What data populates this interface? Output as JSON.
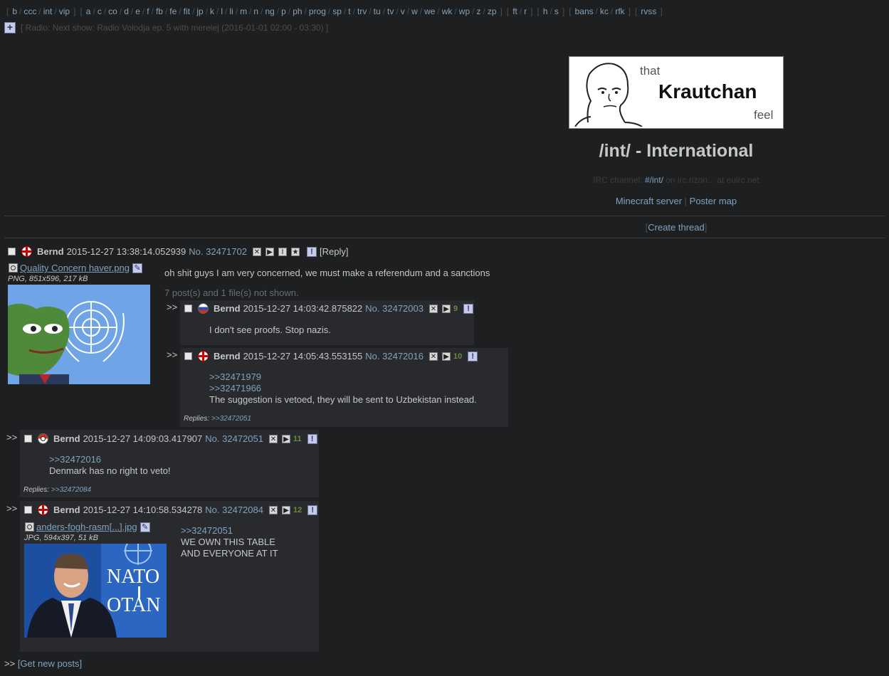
{
  "boardnav": {
    "groups": [
      [
        "b",
        "ccc",
        "int",
        "vip"
      ],
      [
        "a",
        "c",
        "co",
        "d",
        "e",
        "f",
        "fb",
        "fe",
        "fit",
        "jp",
        "k",
        "l",
        "li",
        "m",
        "n",
        "ng",
        "p",
        "ph",
        "prog",
        "sp",
        "t",
        "trv",
        "tu",
        "tv",
        "v",
        "w",
        "we",
        "wk",
        "wp",
        "z",
        "zp"
      ],
      [
        "ft",
        "r"
      ],
      [
        "h",
        "s"
      ],
      [
        "bans",
        "kc",
        "rfk"
      ],
      [
        "rvss"
      ]
    ]
  },
  "radio": {
    "text": "[ Radio: Next show: Radio Volodja ep. 5 with merelej (2016-01-01 02:00 - 03:30) ]"
  },
  "banner": {
    "that": "that",
    "krautchan": "Krautchan",
    "feel": "feel"
  },
  "board": {
    "title": "/int/ - International",
    "irc_prefix": "IRC channel: ",
    "irc_channel": "#/int/",
    "irc_suffix": " on irc.rizon... at euirc.net",
    "minecraft": "Minecraft server",
    "postermap": "Poster map",
    "create_thread": "Create thread"
  },
  "op": {
    "name": "Bernd",
    "date": "2015-12-27 13:38:14.052939",
    "no_label": "No.",
    "no": "32471702",
    "reply_label": "[Reply]",
    "filename": "Quality Concern haver.png",
    "fileinfo": "PNG, 851x596, 217 kB",
    "body": "oh shit guys I am very concerned, we must make a referendum and a sanctions",
    "omitted": "7 post(s) and 1 file(s) not shown."
  },
  "replies": [
    {
      "name": "Bernd",
      "date": "2015-12-27 14:03:42.875822",
      "no": "32472003",
      "count": "9",
      "lines": [
        "I don't see proofs. Stop nazis."
      ]
    },
    {
      "name": "Bernd",
      "date": "2015-12-27 14:05:43.553155",
      "no": "32472016",
      "count": "10",
      "quotes": [
        ">>32471979",
        ">>32471966"
      ],
      "lines": [
        "The suggestion is vetoed, they will be sent to Uzbekistan instead."
      ],
      "replies_label": "Replies:",
      "replies_link": ">>32472051"
    },
    {
      "name": "Bernd",
      "date": "2015-12-27 14:09:03.417907",
      "no": "32472051",
      "count": "11",
      "quotes": [
        ">>32472016"
      ],
      "lines": [
        "Denmark has no right to veto!"
      ],
      "replies_label": "Replies:",
      "replies_link": ">>32472084"
    },
    {
      "name": "Bernd",
      "date": "2015-12-27 14:10:58.534278",
      "no": "32472084",
      "count": "12",
      "filename": "anders-fogh-rasm[...].jpg",
      "fileinfo": "JPG, 594x397, 51 kB",
      "quotes": [
        ">>32472051"
      ],
      "lines": [
        "WE OWN THIS TABLE",
        "AND EVERYONE AT IT"
      ]
    }
  ],
  "arrow": ">>",
  "no_label": "No.",
  "nato_text": [
    "NATO",
    "OTAN"
  ],
  "getnew": {
    "prefix": ">>",
    "label": "[Get new posts]"
  }
}
